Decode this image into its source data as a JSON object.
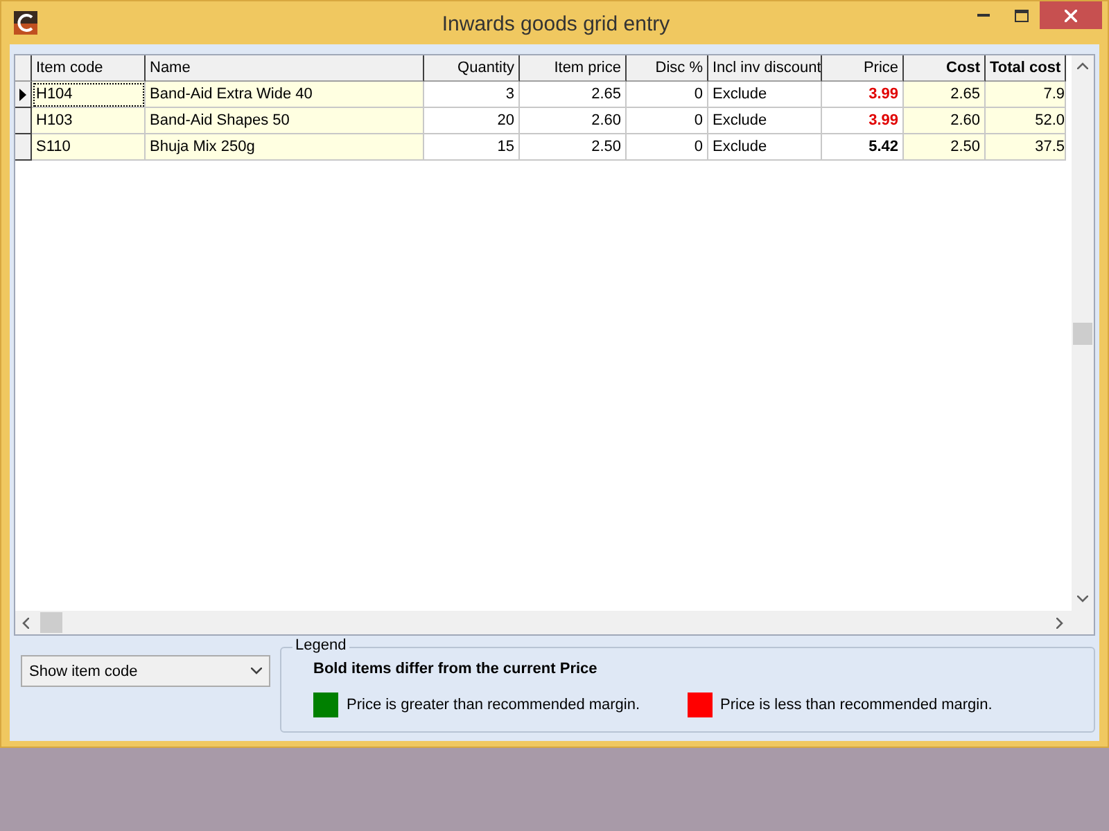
{
  "window": {
    "title": "Inwards goods grid entry"
  },
  "grid": {
    "columns": [
      {
        "label": "Item code",
        "bold": false
      },
      {
        "label": "Name",
        "bold": false
      },
      {
        "label": "Quantity",
        "bold": false
      },
      {
        "label": "Item price",
        "bold": false
      },
      {
        "label": "Disc %",
        "bold": false
      },
      {
        "label": "Incl inv discount",
        "bold": false
      },
      {
        "label": "Price",
        "bold": false
      },
      {
        "label": "Cost",
        "bold": true
      },
      {
        "label": "Total cost",
        "bold": true
      }
    ],
    "rows": [
      {
        "selected": true,
        "item_code": "H104",
        "name": "Band-Aid Extra Wide 40",
        "quantity": "3",
        "item_price": "2.65",
        "disc": "0",
        "incl": "Exclude",
        "price": {
          "text": "3.99",
          "bold": true,
          "color": "#e00000"
        },
        "cost": "2.65",
        "total_cost": "7.9"
      },
      {
        "selected": false,
        "item_code": "H103",
        "name": "Band-Aid Shapes 50",
        "quantity": "20",
        "item_price": "2.60",
        "disc": "0",
        "incl": "Exclude",
        "price": {
          "text": "3.99",
          "bold": true,
          "color": "#e00000"
        },
        "cost": "2.60",
        "total_cost": "52.0"
      },
      {
        "selected": false,
        "item_code": "S110",
        "name": "Bhuja Mix 250g",
        "quantity": "15",
        "item_price": "2.50",
        "disc": "0",
        "incl": "Exclude",
        "price": {
          "text": "5.42",
          "bold": true,
          "color": "#000000"
        },
        "cost": "2.50",
        "total_cost": "37.5"
      }
    ]
  },
  "view_select": {
    "value": "Show item code"
  },
  "legend": {
    "title": "Legend",
    "note": "Bold items differ from the current Price",
    "items": [
      {
        "color": "#008000",
        "text": "Price is greater than recommended margin."
      },
      {
        "color": "#ff0000",
        "text": "Price is less than recommended margin."
      }
    ]
  }
}
